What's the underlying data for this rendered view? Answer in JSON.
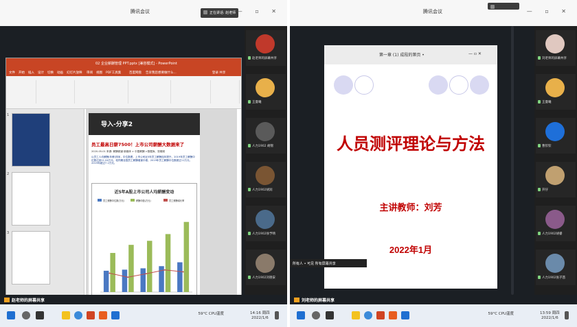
{
  "left": {
    "meeting_title": "腾讯会议",
    "speaker": "正在讲话: 赵老师",
    "window_buttons": "— ▫ ✕",
    "share_label": "赵老师的屏幕共享",
    "ppt": {
      "title": "02 企业薪酬管理 PPT.pptx [兼容模式] - PowerPoint",
      "tabs": [
        "文件",
        "开始",
        "插入",
        "设计",
        "切换",
        "动画",
        "幻灯片放映",
        "审阅",
        "视图",
        "PDF工具集",
        "百度网盘",
        "告诉我您想要做什么..."
      ],
      "login": "登录  共享",
      "slide": {
        "heading": "导入-分享2",
        "article_title": "员工最高日薪7500！上市公司薪酬大数据来了",
        "meta": "2020-05-01 来源: 薪酬频道·新媒体 > 中国薪酬 >数据库、张娟娟",
        "paragraph": "以员工人均薪酬(年薪)排序，中位数看，上市公司近5年员工薪酬连年提升，2019年员工薪酬中位数达到11.04万元，较同期全国员工薪酬增速平稳，2019年员工薪酬中位数超过11万元，2019年超过7.1万元。",
        "chart_title": "近5年A股上市公司人均薪酬变动"
      },
      "status_left": "幻灯片 第 6 张，共 31 张   中文(中国)",
      "status_right": "备注  批注  69%"
    },
    "participants": [
      {
        "name": "赵老师的屏幕共享",
        "color": "#c0392b"
      },
      {
        "name": "王曼曦",
        "color": "#e8b04a"
      },
      {
        "name": "人力1902 胡锦",
        "color": "#5a5a5a"
      },
      {
        "name": "人力1902胡润",
        "color": "#7a5533"
      },
      {
        "name": "人力1902徐予晴",
        "color": "#4a6a8a"
      },
      {
        "name": "人力1902刘德安",
        "color": "#8a7a6a"
      }
    ],
    "taskbar": {
      "weather": "59°C CPU温度",
      "clock": "14:16 周四",
      "date": "2022/1/6"
    }
  },
  "right": {
    "meeting_title": "腾讯会议",
    "window_buttons": "— ▫ ✕",
    "share_label": "刘老师的屏幕共享",
    "slide_header": "第一章 (1) 成段的第页 •",
    "slide_header_right": "— ▫ ✕",
    "slide_title": "人员测评理论与方法",
    "teacher": "主讲教师：刘芳",
    "date": "2022年1月",
    "float_bar": "所有人 • 可见 所有屏幕共享",
    "participants": [
      {
        "name": "刘老师的屏幕共享",
        "color": "#e0c8c0"
      },
      {
        "name": "王曼曦",
        "color": "#e8b04a"
      },
      {
        "name": "曹钦钦",
        "color": "#1e6fd9"
      },
      {
        "name": "开仔",
        "color": "#c0a070"
      },
      {
        "name": "人力1902胡睿",
        "color": "#8a5a8a"
      },
      {
        "name": "人力1902张子茜",
        "color": "#6a8aaa"
      }
    ],
    "taskbar": {
      "weather": "59°C CPU温度",
      "clock": "13:59 周四",
      "date": "2022/1/6"
    }
  },
  "chart_data": {
    "type": "bar",
    "title": "近5年A股上市公司人均薪酬变动",
    "categories": [
      "2015年",
      "2016年",
      "2017年",
      "2018年",
      "2019年"
    ],
    "series": [
      {
        "name": "员工薪酬中位数(万元)",
        "values": [
          7.9,
          8.3,
          8.8,
          9.6,
          11.04
        ],
        "color": "#4a78c2"
      },
      {
        "name": "薪酬均值(万元)",
        "values": [
          14.5,
          17.5,
          19.0,
          21.5,
          26.0
        ],
        "color": "#9bbb59"
      },
      {
        "name": "员工薪酬增长率",
        "values": [
          7.0,
          5.5,
          6.8,
          8.2,
          7.5
        ],
        "color": "#c0504d"
      }
    ],
    "ylim": [
      0,
      30
    ]
  }
}
